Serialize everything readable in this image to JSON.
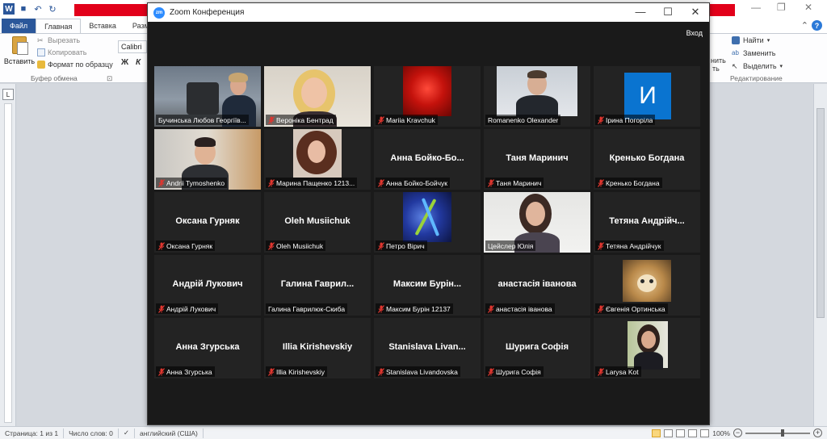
{
  "word": {
    "tabs": {
      "file": "Файл",
      "home": "Главная",
      "insert": "Вставка",
      "layout": "Разме"
    },
    "clipboard": {
      "paste": "Вставить",
      "cut": "Вырезать",
      "copy": "Копировать",
      "format_painter": "Формат по образцу",
      "group": "Буфер обмена"
    },
    "font": {
      "name": "Calibri (С",
      "bold": "Ж",
      "italic": "К"
    },
    "editing": {
      "find": "Найти",
      "replace": "Заменить",
      "select": "Выделить",
      "group": "Редактирование",
      "frag1": "нить",
      "frag2": "ть"
    },
    "status": {
      "page": "Страница: 1 из 1",
      "words": "Число слов: 0",
      "lang": "английский (США)",
      "zoom": "100%"
    }
  },
  "zoom": {
    "title": "Zoom Конференция",
    "exit_label": "Вход",
    "tiles": [
      {
        "label": "Бучинська Любов Георгіїв...",
        "video": "office-woman",
        "speaking": true,
        "muted": false
      },
      {
        "label": "Вероніка Бентрад",
        "video": "blonde-woman",
        "muted": true
      },
      {
        "label": "Mariia Kravchuk",
        "video": "red-flower",
        "muted": true
      },
      {
        "label": "Romanenko Olexander",
        "video": "man-suit",
        "muted": false
      },
      {
        "label": "Ірина Погоріла",
        "video": "initial-avatar",
        "avatar_letter": "И",
        "muted": true
      },
      {
        "label": "Andrii Tymoshenko",
        "video": "young-man",
        "muted": true
      },
      {
        "label": "Марина Пащенко 1213...",
        "video": "curly-woman",
        "muted": true
      },
      {
        "center_name": "Анна  Бойко-Бо...",
        "label": "Анна Бойко-Бойчук",
        "muted": true
      },
      {
        "center_name": "Таня Маринич",
        "label": "Таня Маринич",
        "muted": true
      },
      {
        "center_name": "Кренько Богдана",
        "label": "Кренько Богдана",
        "muted": true
      },
      {
        "center_name": "Оксана Гурняк",
        "label": "Оксана Гурняк",
        "muted": true
      },
      {
        "center_name": "Oleh Musiichuk",
        "label": "Oleh Musiichuk",
        "muted": true
      },
      {
        "label": "Петро Вірич",
        "video": "dna-blue",
        "muted": true
      },
      {
        "label": "Цейслер Юлія",
        "video": "dark-woman",
        "muted": false
      },
      {
        "center_name": "Тетяна  Андрійч...",
        "label": "Тетяна Андрійчук",
        "muted": true
      },
      {
        "center_name": "Андрій Лукович",
        "label": "Андрій Лукович",
        "muted": true
      },
      {
        "center_name": "Галина  Гаврил...",
        "label": "Галина Гаврилюк-Скиба",
        "muted": false
      },
      {
        "center_name": "Максим  Бурін...",
        "label": "Максим Бурін 12137",
        "muted": true
      },
      {
        "center_name": "анастасія іванова",
        "label": "анастасія іванова",
        "muted": true
      },
      {
        "label": "Євгенія Ортинська",
        "video": "kitten",
        "muted": true
      },
      {
        "center_name": "Анна Згурська",
        "label": "Анна Згурська",
        "muted": true
      },
      {
        "center_name": "Illia Kirishevskiy",
        "label": "Illia Kirishevskiy",
        "muted": true
      },
      {
        "center_name": "Stanislava  Livan...",
        "label": "Stanislava Livandovska",
        "muted": true
      },
      {
        "center_name": "Шурига Софія",
        "label": "Шурига Софія",
        "muted": true
      },
      {
        "label": "Larysa Kot",
        "video": "smiling-woman",
        "muted": true
      }
    ]
  }
}
